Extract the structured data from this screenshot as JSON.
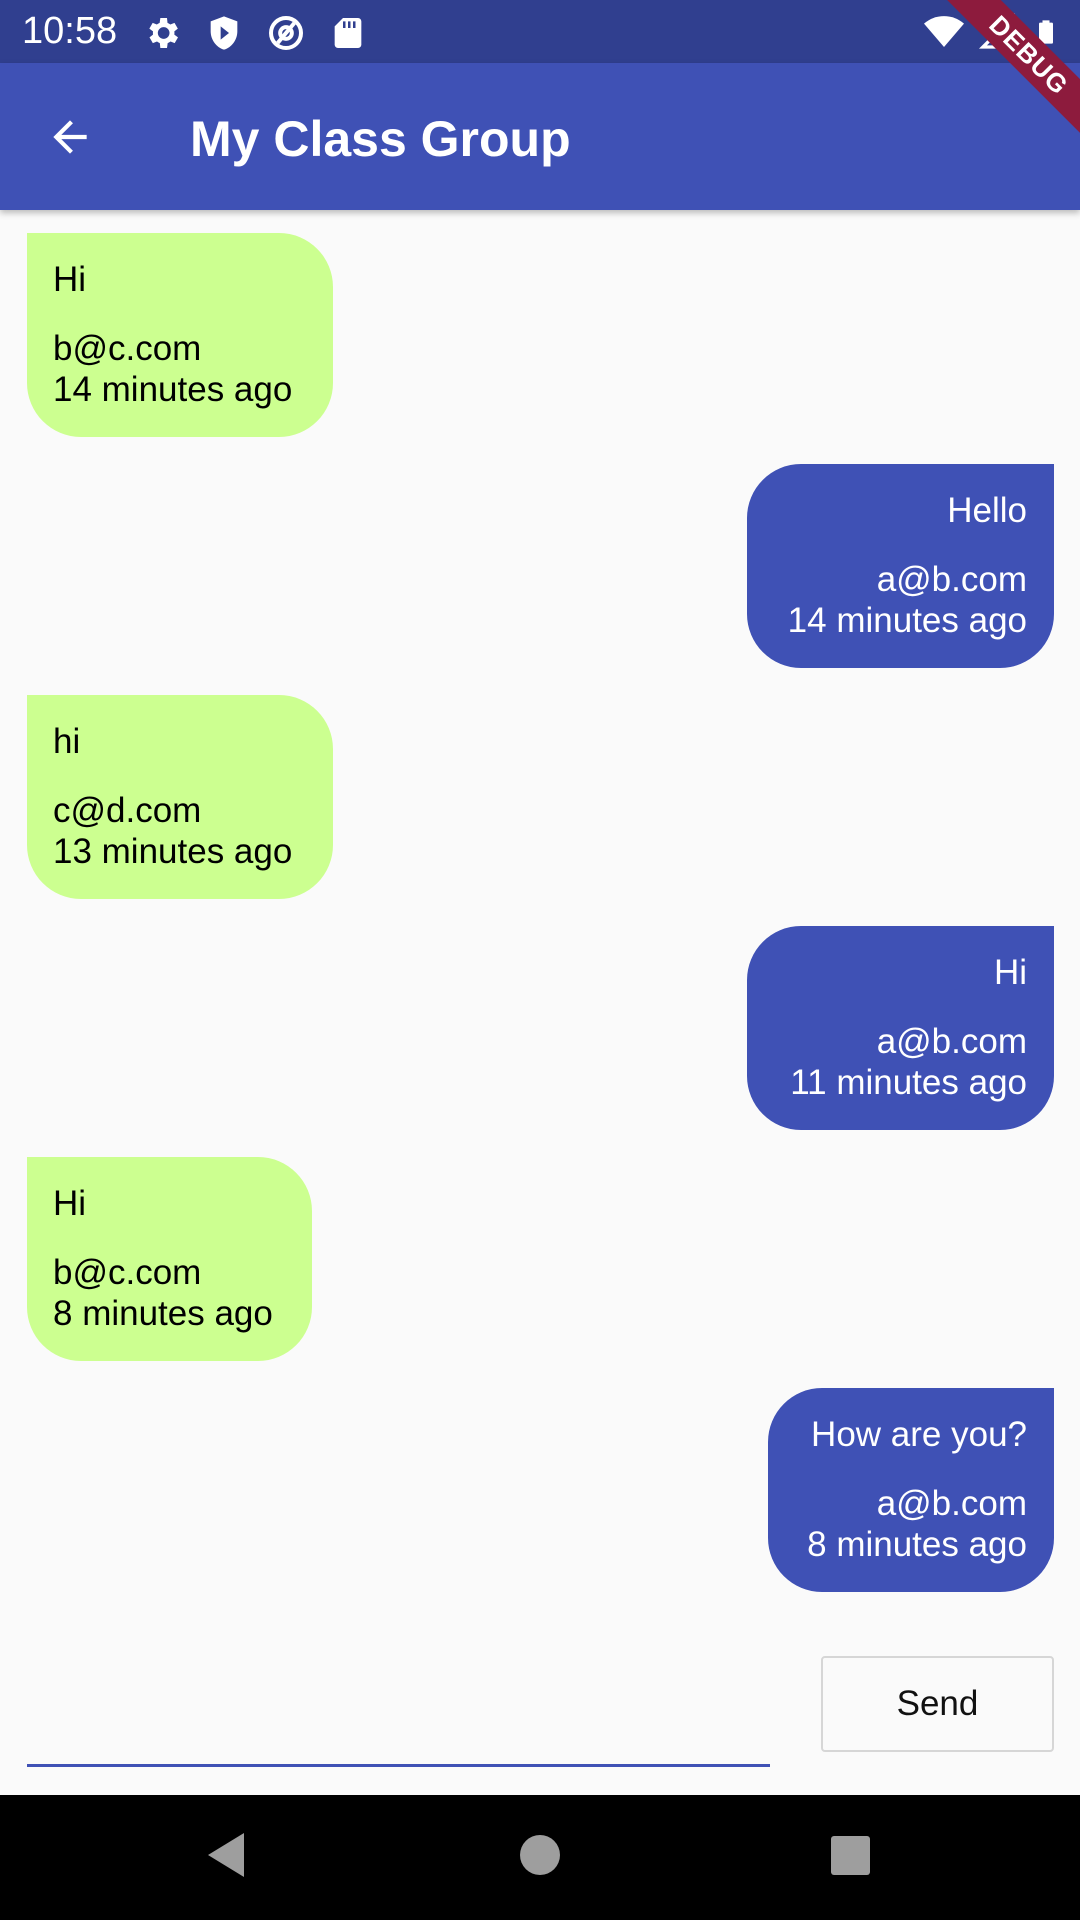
{
  "status_bar": {
    "time": "10:58",
    "left_icons": [
      "gear-icon",
      "shield-icon",
      "at-sign-icon",
      "sd-card-icon"
    ],
    "right_icons": [
      "wifi-icon",
      "signal-icon",
      "battery-icon"
    ]
  },
  "debug_banner": "DEBUG",
  "app_bar": {
    "back_icon": "arrow-left-icon",
    "title": "My Class Group"
  },
  "messages": [
    {
      "direction": "in",
      "text": "Hi",
      "sender": "b@c.com",
      "time": "14 minutes ago"
    },
    {
      "direction": "out",
      "text": "Hello",
      "sender": "a@b.com",
      "time": "14 minutes ago"
    },
    {
      "direction": "in",
      "text": "hi",
      "sender": "c@d.com",
      "time": "13 minutes ago"
    },
    {
      "direction": "out",
      "text": "Hi",
      "sender": "a@b.com",
      "time": "11 minutes ago"
    },
    {
      "direction": "in",
      "text": "Hi",
      "sender": "b@c.com",
      "time": "8 minutes ago"
    },
    {
      "direction": "out",
      "text": "How are you?",
      "sender": "a@b.com",
      "time": "8 minutes ago"
    }
  ],
  "composer": {
    "input_value": "",
    "send_label": "Send"
  },
  "nav_bar": {
    "icons": [
      "nav-back-icon",
      "nav-home-icon",
      "nav-recents-icon"
    ]
  },
  "colors": {
    "status_bar": "#303f8f",
    "app_bar": "#3f51b5",
    "incoming_bubble": "#ccff90",
    "outgoing_bubble": "#3f51b5",
    "debug_ribbon": "#8d1b3d"
  }
}
